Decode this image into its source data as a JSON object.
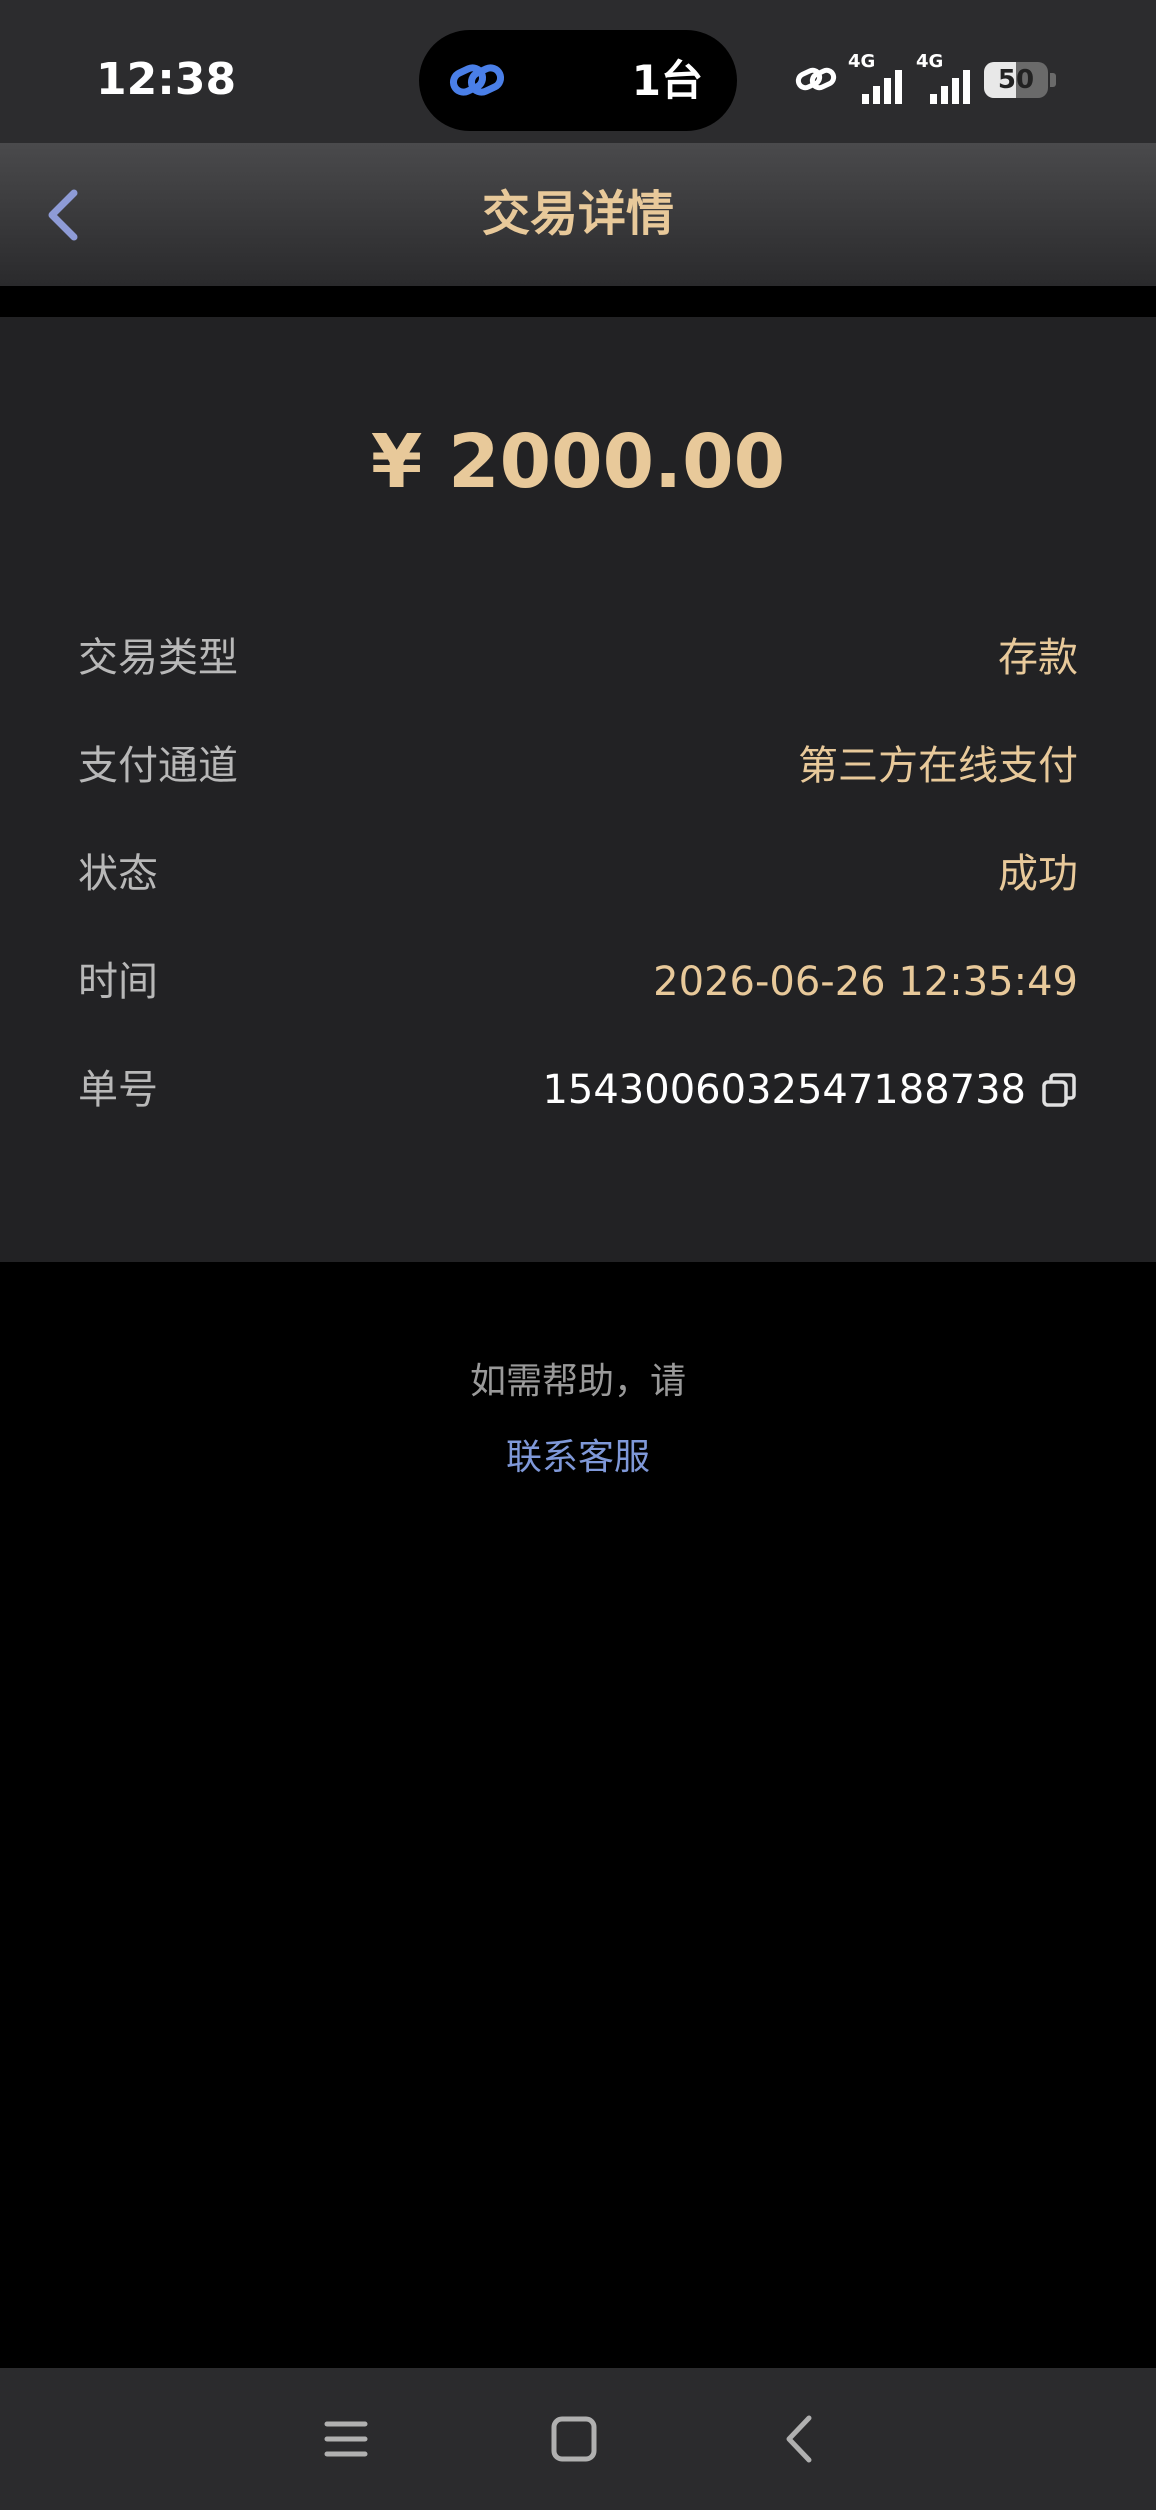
{
  "status_bar": {
    "time": "12:38",
    "island_text": "1台",
    "network_1": "4G",
    "network_2": "4G",
    "battery": "50",
    "battery_level_percent": 50
  },
  "header": {
    "title": "交易详情",
    "back_icon": "chevron-left-icon"
  },
  "transaction": {
    "amount": "¥ 2000.00",
    "rows": [
      {
        "label": "交易类型",
        "value": "存款"
      },
      {
        "label": "支付通道",
        "value": "第三方在线支付"
      },
      {
        "label": "状态",
        "value": "成功"
      },
      {
        "label": "时间",
        "value": "2026-06-26 12:35:49"
      },
      {
        "label": "单号",
        "value": "1543006032547188738"
      }
    ],
    "copy_icon": "copy-icon"
  },
  "help": {
    "prompt": "如需帮助，请",
    "link": "联系客服"
  },
  "system_nav": {
    "menu_icon": "menu-icon",
    "home_icon": "home-square-icon",
    "back_icon": "back-chevron-icon"
  },
  "colors": {
    "accent_gold": "#e8c99a",
    "link_blue": "#7f98d8",
    "card_bg": "#222224"
  }
}
